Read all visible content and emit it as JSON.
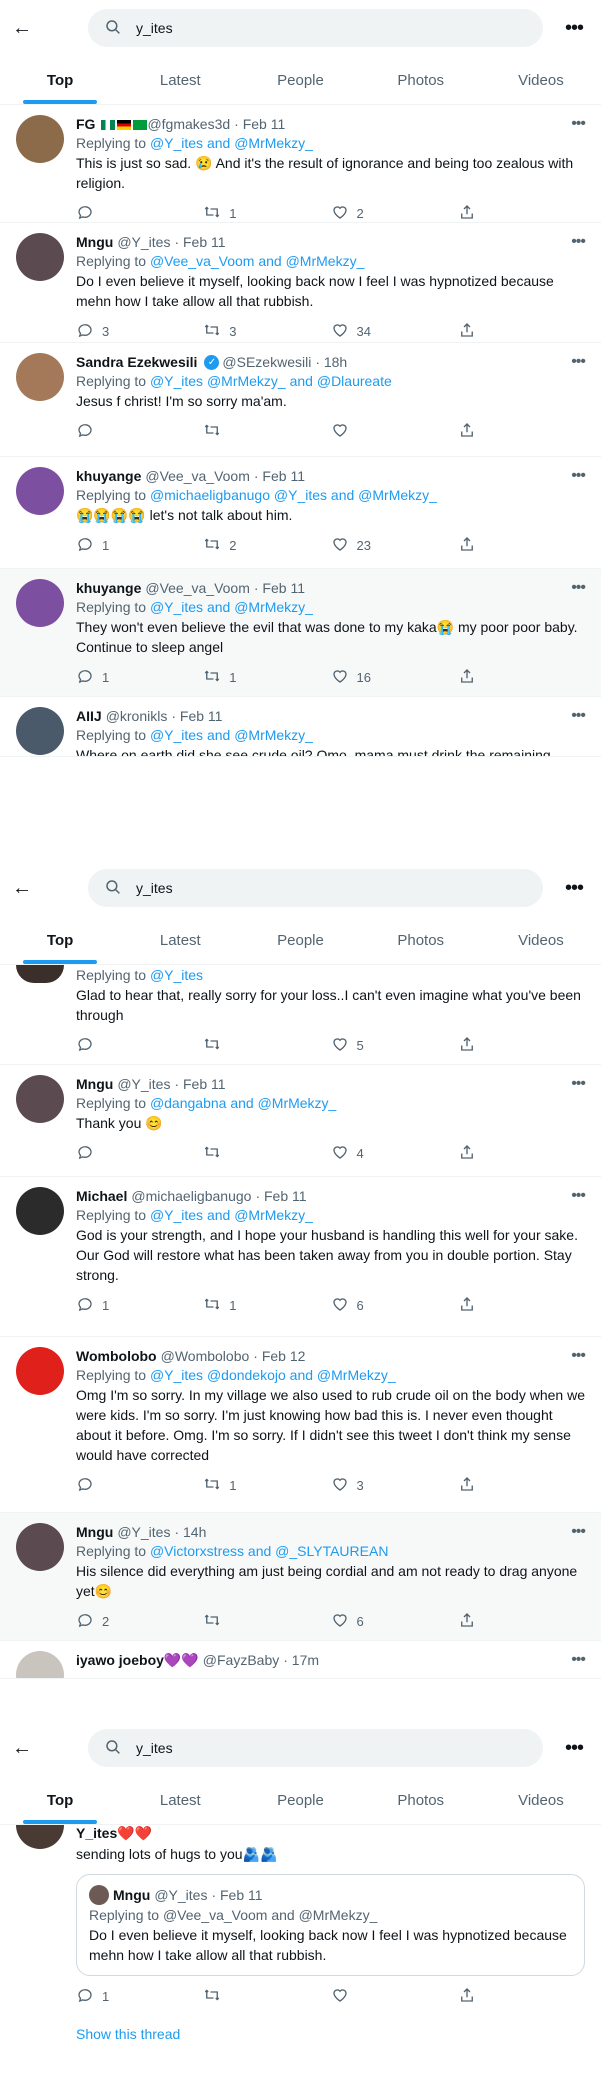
{
  "search": {
    "query": "y_ites"
  },
  "tabs": [
    "Top",
    "Latest",
    "People",
    "Photos",
    "Videos"
  ],
  "screen1": [
    {
      "name": "FG",
      "handle": "@fgmakes3d",
      "time": "· Feb 11",
      "reply_prefix": "Replying to ",
      "reply_to": "@Y_ites and @MrMekzy_",
      "text": "This is just so sad. 😢 And it's the result of ignorance and being too zealous with religion.",
      "replies": "",
      "retweets": "1",
      "likes": "2",
      "avatar_color": "#8b6b4a"
    },
    {
      "name": "Mngu",
      "handle": "@Y_ites",
      "time": "· Feb 11",
      "reply_prefix": "Replying to ",
      "reply_to": "@Vee_va_Voom and @MrMekzy_",
      "text": "Do I even believe it myself, looking back now I feel I was hypnotized because mehn how I take allow all that rubbish.",
      "replies": "3",
      "retweets": "3",
      "likes": "34",
      "avatar_color": "#5b4a4f"
    },
    {
      "name": "Sandra Ezekwesili",
      "handle": "@SEzekwesili",
      "time": "· 18h",
      "reply_prefix": "Replying to ",
      "reply_to": "@Y_ites @MrMekzy_ and @Dlaureate",
      "text": "Jesus f christ! I'm so sorry ma'am.",
      "replies": "",
      "retweets": "",
      "likes": "",
      "avatar_color": "#a3795a"
    },
    {
      "name": "khuyange",
      "handle": "@Vee_va_Voom",
      "time": "· Feb 11",
      "reply_prefix": "Replying to ",
      "reply_to": "@michaeligbanugo @Y_ites and @MrMekzy_",
      "text": "😭😭😭😭 let's not talk about him.",
      "replies": "1",
      "retweets": "2",
      "likes": "23",
      "avatar_color": "#7d4fa0"
    },
    {
      "name": "khuyange",
      "handle": "@Vee_va_Voom",
      "time": "· Feb 11",
      "reply_prefix": "Replying to ",
      "reply_to": "@Y_ites and @MrMekzy_",
      "text": "They won't even believe the evil that was done to my kaka😭 my poor poor baby. Continue to sleep angel",
      "replies": "1",
      "retweets": "1",
      "likes": "16",
      "avatar_color": "#7d4fa0"
    },
    {
      "name": "AIIJ",
      "handle": "@kronikls",
      "time": "· Feb 11",
      "reply_prefix": "Replying to ",
      "reply_to": "@Y_ites and @MrMekzy_",
      "text": "Where on earth did she see crude oil? Omo, mama must drink the remaining",
      "replies": "",
      "retweets": "",
      "likes": "",
      "avatar_color": "#4a5a6a"
    }
  ],
  "screen2_partial": {
    "reply_prefix": "Replying to ",
    "reply_to": "@Y_ites",
    "text": "Glad to hear that, really sorry for your loss..I can't even imagine what you've been through",
    "likes": "5"
  },
  "screen2": [
    {
      "name": "Mngu",
      "handle": "@Y_ites",
      "time": "· Feb 11",
      "reply_prefix": "Replying to ",
      "reply_to": "@dangabna and @MrMekzy_",
      "text": "Thank you 😊",
      "replies": "",
      "retweets": "",
      "likes": "4",
      "avatar_color": "#5b4a4f"
    },
    {
      "name": "Michael",
      "handle": "@michaeligbanugo",
      "time": "· Feb 11",
      "reply_prefix": "Replying to ",
      "reply_to": "@Y_ites and @MrMekzy_",
      "text": "God is your strength, and I hope your husband is handling this well for your sake. Our God will restore what has been taken away from you in double portion. Stay strong.",
      "replies": "1",
      "retweets": "1",
      "likes": "6",
      "avatar_color": "#2b2b2b"
    },
    {
      "name": "Wombolobo",
      "handle": "@Wombolobo",
      "time": "· Feb 12",
      "reply_prefix": "Replying to ",
      "reply_to": "@Y_ites @dondekojo and @MrMekzy_",
      "text": "Omg I'm so sorry. In my village we also used to rub crude oil on the body when we were kids. I'm so sorry. I'm just knowing how bad this is. I never even thought about it before. Omg. I'm so sorry. If I didn't see this tweet I don't think my sense would have corrected",
      "replies": "",
      "retweets": "1",
      "likes": "3",
      "avatar_color": "#e0201b"
    },
    {
      "name": "Mngu",
      "handle": "@Y_ites",
      "time": "· 14h",
      "reply_prefix": "Replying to ",
      "reply_to": "@Victorxstress and @_SLYTAUREAN",
      "text": "His silence did everything am just being cordial and am not ready to drag anyone yet😊",
      "replies": "2",
      "retweets": "",
      "likes": "6",
      "avatar_color": "#5b4a4f"
    }
  ],
  "screen2_last": {
    "name": "iyawo joeboy💜💜",
    "handle": "@FayzBaby",
    "time": "· 17m"
  },
  "screen3_top": {
    "name": "Y_ites❤️❤️",
    "text": "sending lots of hugs to you🫂🫂",
    "quote": {
      "name": "Mngu",
      "handle": "@Y_ites",
      "time": "· Feb 11",
      "reply_prefix": "Replying to ",
      "reply_to": "@Vee_va_Voom and @MrMekzy_",
      "text": "Do I even believe it myself, looking back now I feel I was hypnotized because mehn how I take allow all that rubbish."
    },
    "replies": "1",
    "show_thread": "Show this thread"
  }
}
